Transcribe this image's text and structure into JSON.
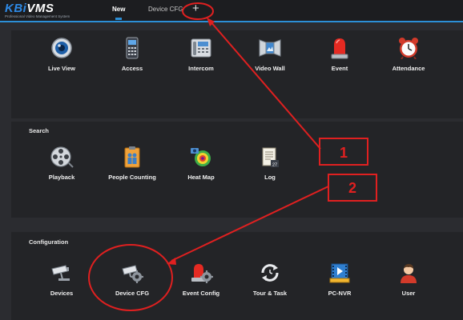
{
  "app": {
    "logo_text": "KBiVMS",
    "logo_subtitle": "Professional Video Management System"
  },
  "tabs": [
    {
      "label": "New",
      "active": true
    },
    {
      "label": "Device CFG",
      "active": false
    },
    {
      "label": "+"
    }
  ],
  "sections": {
    "main": {
      "items": [
        {
          "label": "Live View",
          "icon": "camera-lens-icon"
        },
        {
          "label": "Access",
          "icon": "access-terminal-icon"
        },
        {
          "label": "Intercom",
          "icon": "intercom-phone-icon"
        },
        {
          "label": "Video Wall",
          "icon": "video-wall-icon"
        },
        {
          "label": "Event",
          "icon": "alarm-siren-icon"
        },
        {
          "label": "Attendance",
          "icon": "alarm-clock-icon"
        }
      ]
    },
    "search": {
      "title": "Search",
      "items": [
        {
          "label": "Playback",
          "icon": "film-reel-icon"
        },
        {
          "label": "People Counting",
          "icon": "people-counting-icon"
        },
        {
          "label": "Heat Map",
          "icon": "heat-map-icon"
        },
        {
          "label": "Log",
          "icon": "log-document-icon"
        }
      ]
    },
    "configuration": {
      "title": "Configuration",
      "items": [
        {
          "label": "Devices",
          "icon": "cctv-camera-icon"
        },
        {
          "label": "Device CFG",
          "icon": "camera-gear-icon"
        },
        {
          "label": "Event Config",
          "icon": "siren-gear-icon"
        },
        {
          "label": "Tour & Task",
          "icon": "refresh-clock-icon"
        },
        {
          "label": "PC-NVR",
          "icon": "nvr-film-icon"
        },
        {
          "label": "User",
          "icon": "user-avatar-icon"
        }
      ]
    }
  },
  "annotations": {
    "marker_1": "1",
    "marker_2": "2",
    "color": "#e02020"
  },
  "colors": {
    "accent": "#2c8fd6",
    "background": "#2b2c30",
    "panel": "#232427",
    "annotation": "#e02020"
  }
}
